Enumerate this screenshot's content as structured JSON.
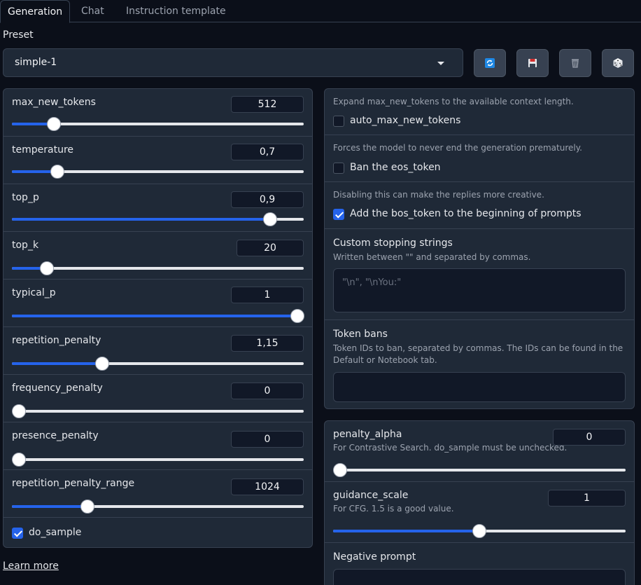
{
  "tabs": [
    {
      "label": "Generation"
    },
    {
      "label": "Chat"
    },
    {
      "label": "Instruction template"
    }
  ],
  "preset": {
    "label": "Preset",
    "value": "simple-1",
    "buttons": [
      "refresh-icon",
      "save-icon",
      "delete-icon",
      "random-icon"
    ]
  },
  "left_params": [
    {
      "name": "max_new_tokens",
      "value": "512",
      "fraction": 0.145
    },
    {
      "name": "temperature",
      "value": "0,7",
      "fraction": 0.157
    },
    {
      "name": "top_p",
      "value": "0,9",
      "fraction": 0.884
    },
    {
      "name": "top_k",
      "value": "20",
      "fraction": 0.12
    },
    {
      "name": "typical_p",
      "value": "1",
      "fraction": 1.0
    },
    {
      "name": "repetition_penalty",
      "value": "1,15",
      "fraction": 0.31
    },
    {
      "name": "frequency_penalty",
      "value": "0",
      "fraction": 0.0
    },
    {
      "name": "presence_penalty",
      "value": "0",
      "fraction": 0.0
    },
    {
      "name": "repetition_penalty_range",
      "value": "1024",
      "fraction": 0.26
    }
  ],
  "do_sample": {
    "label": "do_sample",
    "checked": true
  },
  "learn_more": "Learn more",
  "right_checks": [
    {
      "info": "Expand max_new_tokens to the available context length.",
      "label": "auto_max_new_tokens",
      "checked": false
    },
    {
      "info": "Forces the model to never end the generation prematurely.",
      "label": "Ban the eos_token",
      "checked": false
    },
    {
      "info": "Disabling this can make the replies more creative.",
      "label": "Add the bos_token to the beginning of prompts",
      "checked": true
    }
  ],
  "stopping": {
    "label": "Custom stopping strings",
    "info": "Written between \"\" and separated by commas.",
    "placeholder": "\"\\n\", \"\\nYou:\""
  },
  "token_bans": {
    "label": "Token bans",
    "info_line1": "Token IDs to ban, separated by commas. The IDs can be found in the",
    "info_line2": "Default or Notebook tab."
  },
  "penalty_alpha": {
    "name": "penalty_alpha",
    "info": "For Contrastive Search. do_sample must be unchecked.",
    "value": "0",
    "fraction": 0.0
  },
  "guidance_scale": {
    "name": "guidance_scale",
    "info": "For CFG. 1.5 is a good value.",
    "value": "1",
    "fraction": 0.5
  },
  "negative_prompt": {
    "label": "Negative prompt"
  }
}
